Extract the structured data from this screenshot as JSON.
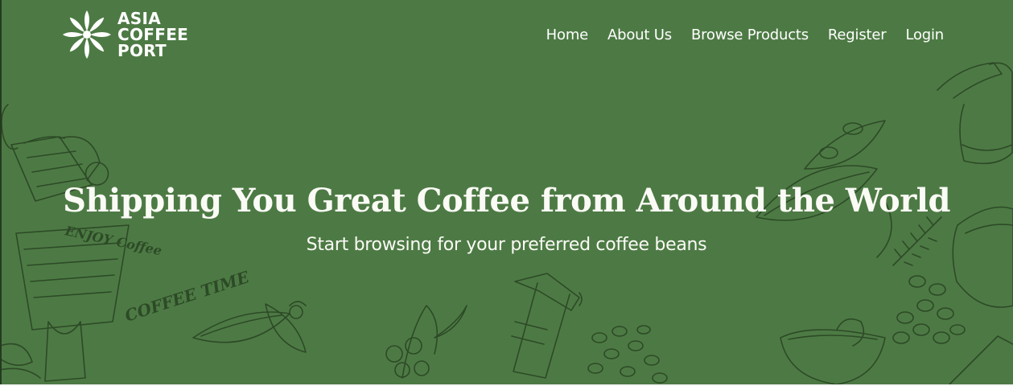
{
  "brand": {
    "line1": "ASIA",
    "line2": "COFFEE",
    "line3": "PORT",
    "logo_icon": "flower-logo-icon"
  },
  "nav": {
    "items": [
      {
        "label": "Home"
      },
      {
        "label": "About Us"
      },
      {
        "label": "Browse Products"
      },
      {
        "label": "Register"
      },
      {
        "label": "Login"
      }
    ]
  },
  "hero": {
    "title": "Shipping You Great Coffee from Around the World",
    "subtitle": "Start browsing for your preferred coffee beans",
    "background_color": "#4d7a44",
    "illustration_color": "#2d4a27",
    "illustration_text": [
      "ENJOY Coffee",
      "COFFEE TIME"
    ]
  }
}
